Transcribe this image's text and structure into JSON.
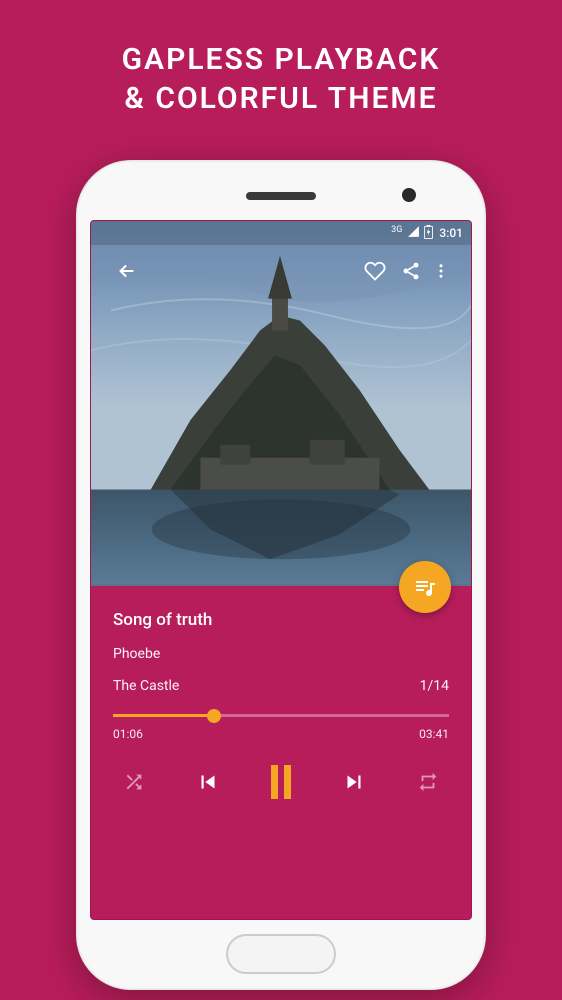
{
  "promo": {
    "title": "GAPLESS PLAYBACK\n& COLORFUL THEME"
  },
  "status_bar": {
    "network": "3G",
    "time": "3:01"
  },
  "player": {
    "song_title": "Song of truth",
    "artist": "Phoebe",
    "album": "The Castle",
    "track_position": "1/14",
    "elapsed": "01:06",
    "duration": "03:41",
    "progress_percent": 30
  },
  "icons": {
    "back": "back-arrow-icon",
    "favorite": "heart-icon",
    "share": "share-icon",
    "more": "more-vert-icon",
    "queue": "queue-music-icon",
    "shuffle": "shuffle-icon",
    "previous": "skip-previous-icon",
    "pause": "pause-icon",
    "next": "skip-next-icon",
    "repeat": "repeat-icon",
    "signal": "signal-icon",
    "battery": "battery-icon"
  },
  "colors": {
    "accent": "#f5a623",
    "background": "#b81d5b"
  }
}
